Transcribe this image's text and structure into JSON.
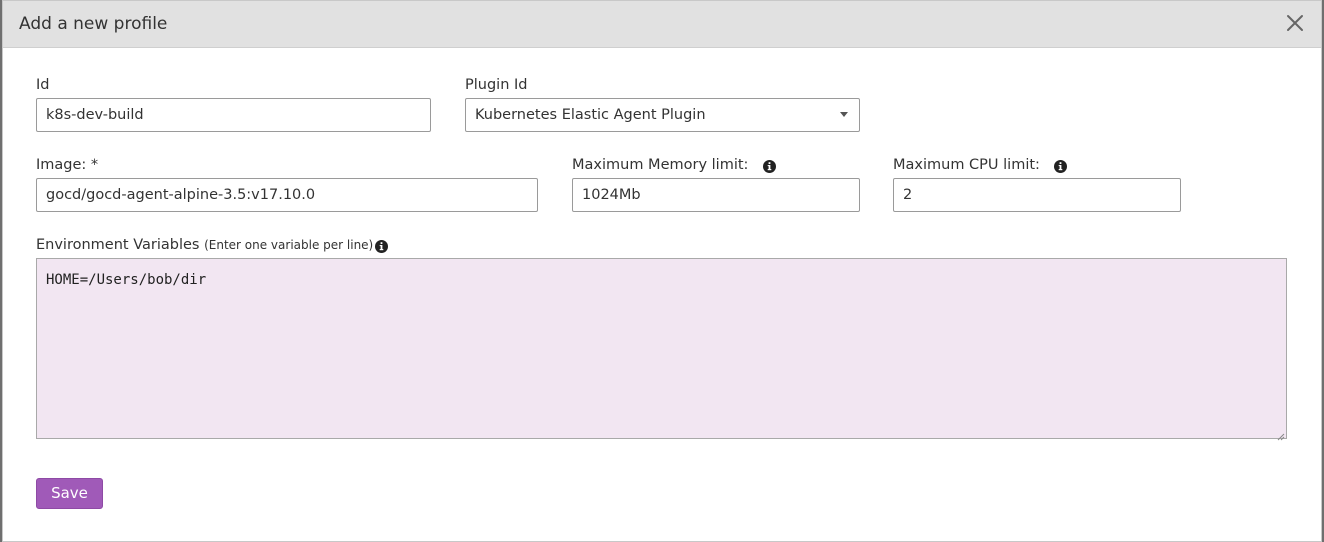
{
  "dialog": {
    "title": "Add a new profile"
  },
  "form": {
    "id": {
      "label": "Id",
      "value": "k8s-dev-build"
    },
    "plugin_id": {
      "label": "Plugin Id",
      "selected": "Kubernetes Elastic Agent Plugin"
    },
    "image": {
      "label": "Image: *",
      "value": "gocd/gocd-agent-alpine-3.5:v17.10.0"
    },
    "max_memory": {
      "label": "Maximum Memory limit:",
      "value": "1024Mb"
    },
    "max_cpu": {
      "label": "Maximum CPU limit:",
      "value": "2"
    },
    "env_vars": {
      "label": "Environment Variables",
      "hint": "(Enter one variable per line)",
      "value": "HOME=/Users/bob/dir"
    }
  },
  "actions": {
    "save_label": "Save"
  },
  "colors": {
    "header_bg": "#e1e1e1",
    "accent": "#a05ab8",
    "textarea_bg": "#f2e6f2"
  },
  "icons": {
    "close": "close-icon",
    "info": "info-icon",
    "dropdown": "chevron-down-icon"
  }
}
